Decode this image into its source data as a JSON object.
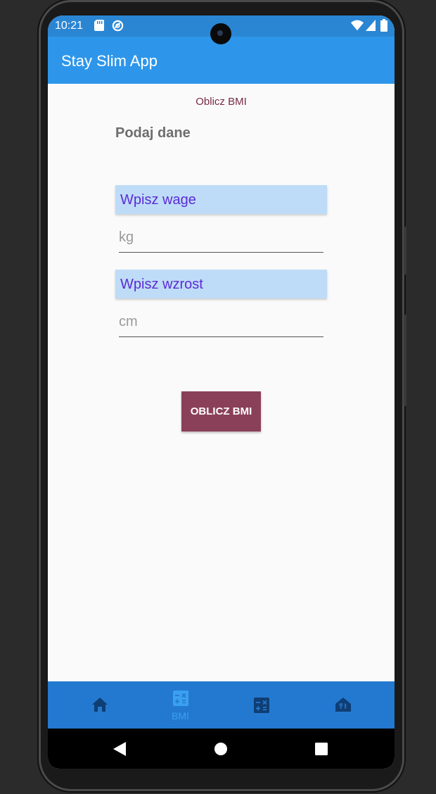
{
  "status_bar": {
    "time": "10:21"
  },
  "app_bar": {
    "title": "Stay Slim App"
  },
  "page": {
    "caption": "Oblicz BMI",
    "section_title": "Podaj dane",
    "weight": {
      "label": "Wpisz wage",
      "placeholder": "kg",
      "value": ""
    },
    "height": {
      "label": "Wpisz wzrost",
      "placeholder": "cm",
      "value": ""
    },
    "calculate_button": "OBLICZ BMI"
  },
  "bottom_nav": {
    "tabs": [
      {
        "icon": "home-icon",
        "label": ""
      },
      {
        "icon": "calculator-icon",
        "label": "BMI",
        "active": true
      },
      {
        "icon": "calculator-icon",
        "label": ""
      },
      {
        "icon": "restaurant-icon",
        "label": ""
      }
    ]
  },
  "colors": {
    "app_bar": "#2d96ea",
    "status_bar": "#2a86d3",
    "bottom_nav": "#2379cf",
    "button": "#8a4058",
    "label_bg": "#bedcf7",
    "label_text": "#5b2ad6"
  }
}
